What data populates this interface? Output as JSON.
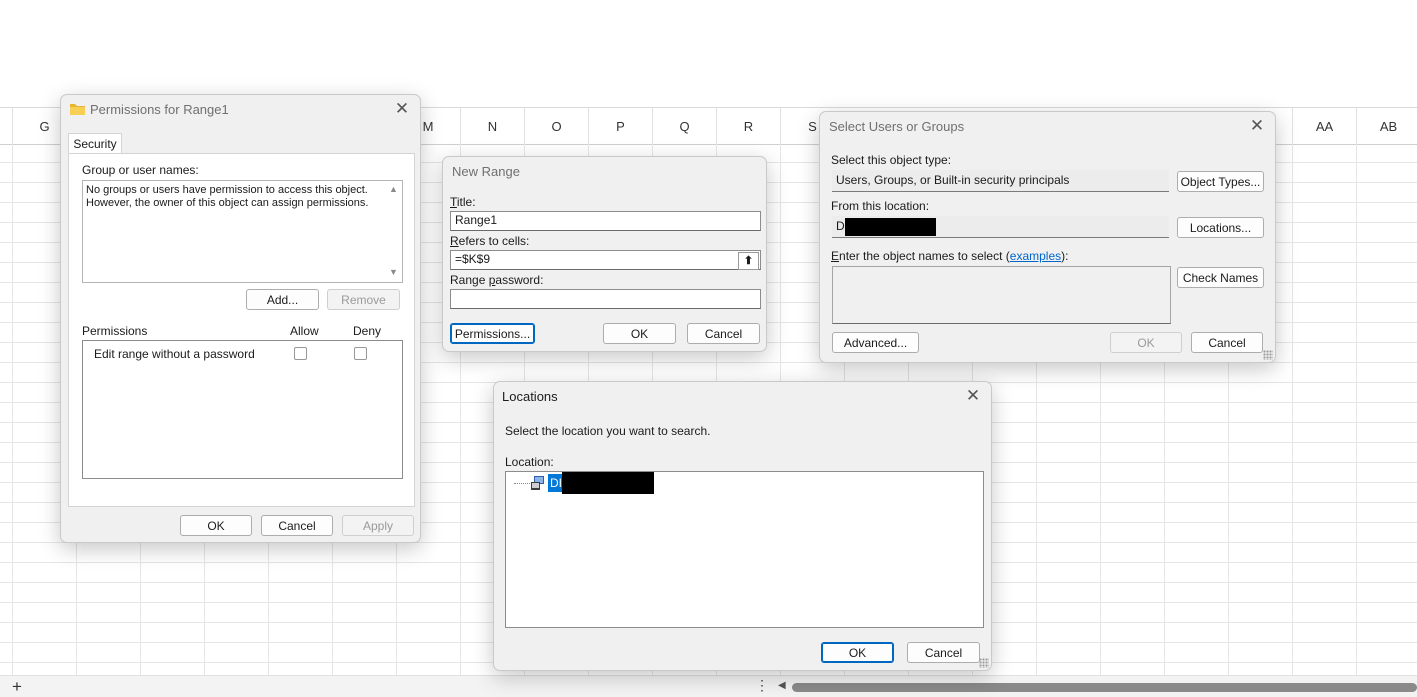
{
  "sheet": {
    "columns": [
      "G",
      "M",
      "N",
      "O",
      "P",
      "Q",
      "R",
      "S",
      "AA",
      "AB"
    ],
    "add_sheet": "+",
    "more": "⋮",
    "scroll_left": "◀"
  },
  "permissions_dialog": {
    "title": "Permissions for Range1",
    "tab": "Security",
    "group_label": "Group or user names:",
    "group_message": "No groups or users have permission to access this object. However, the owner of this object can assign permissions.",
    "add_label": "Add...",
    "remove_label": "Remove",
    "permissions_label": "Permissions",
    "allow_label": "Allow",
    "deny_label": "Deny",
    "permission_item": "Edit range without a password",
    "ok_label": "OK",
    "cancel_label": "Cancel",
    "apply_label": "Apply"
  },
  "new_range_dialog": {
    "title": "New Range",
    "title_label_pre": "",
    "title_label_u": "T",
    "title_label_post": "itle:",
    "title_value": "Range1",
    "refers_label_u": "R",
    "refers_label_post": "efers to cells:",
    "refers_value": "=$K$9",
    "password_label_pre": "Range ",
    "password_label_u": "p",
    "password_label_post": "assword:",
    "password_value": "",
    "permissions_label": "Permissions...",
    "ok_label": "OK",
    "cancel_label": "Cancel"
  },
  "select_users_dialog": {
    "title": "Select Users or Groups",
    "object_type_label": "Select this object type:",
    "object_type_value": "Users, Groups, or Built-in security principals",
    "object_types_button": "Object Types...",
    "location_label": "From this location:",
    "location_value": "DI",
    "locations_button": "Locations...",
    "enter_label_u": "E",
    "enter_label_post": "nter the object names to select (",
    "examples_link": "examples",
    "enter_label_end": "):",
    "check_names_button": "Check Names",
    "advanced_button": "Advanced...",
    "ok_label": "OK",
    "cancel_label": "Cancel"
  },
  "locations_dialog": {
    "title": "Locations",
    "instruction": "Select the location you want to search.",
    "location_label": "Location:",
    "tree_item": "DI",
    "ok_label": "OK",
    "cancel_label": "Cancel"
  }
}
